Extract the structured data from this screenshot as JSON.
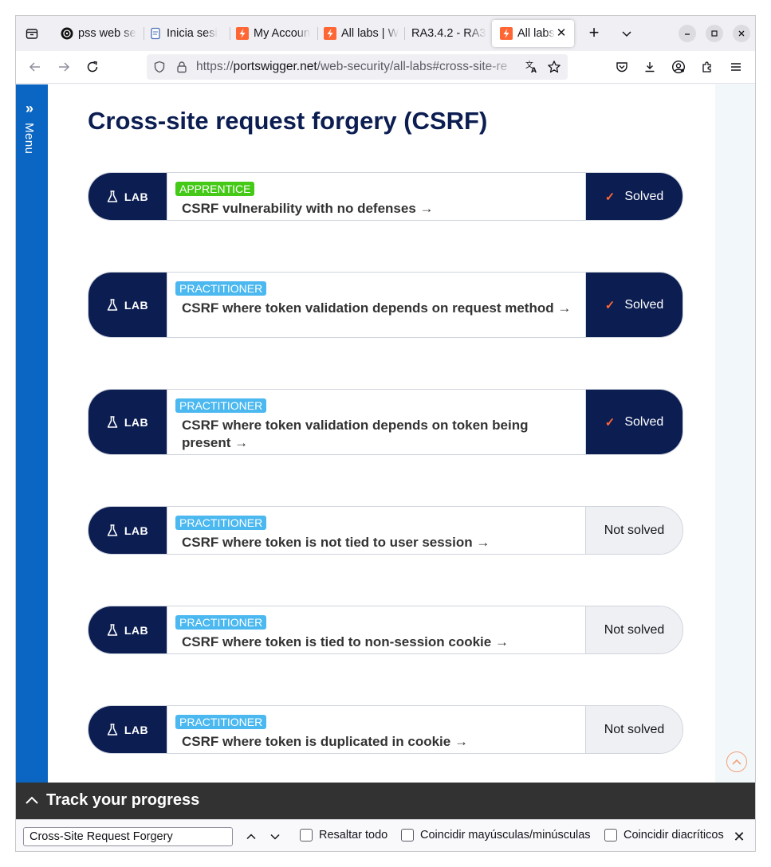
{
  "browser": {
    "tabs": [
      {
        "label": "pss web se",
        "icon": "openai-icon"
      },
      {
        "label": "Inicia sesi",
        "icon": "document-icon"
      },
      {
        "label": "My Accoun",
        "icon": "portswigger-icon"
      },
      {
        "label": "All labs | W",
        "icon": "portswigger-icon"
      },
      {
        "label": "RA3.4.2 - RA3",
        "icon": "none"
      },
      {
        "label": "All labs |",
        "icon": "portswigger-icon",
        "active": true
      }
    ],
    "url": {
      "scheme": "https://",
      "host": "portswigger.net",
      "path": "/web-security/all-labs#cross-site-re"
    }
  },
  "sidebar": {
    "menu_label": "Menu"
  },
  "page": {
    "title": "Cross-site request forgery (CSRF)",
    "badge_label": "LAB",
    "labs": [
      {
        "level": "APPRENTICE",
        "title": "CSRF vulnerability with no defenses",
        "status": "Solved",
        "solved": true
      },
      {
        "level": "PRACTITIONER",
        "title": "CSRF where token validation depends on request method",
        "status": "Solved",
        "solved": true
      },
      {
        "level": "PRACTITIONER",
        "title": "CSRF where token validation depends on token being present",
        "status": "Solved",
        "solved": true
      },
      {
        "level": "PRACTITIONER",
        "title": "CSRF where token is not tied to user session",
        "status": "Not solved",
        "solved": false
      },
      {
        "level": "PRACTITIONER",
        "title": "CSRF where token is tied to non-session cookie",
        "status": "Not solved",
        "solved": false
      },
      {
        "level": "PRACTITIONER",
        "title": "CSRF where token is duplicated in cookie",
        "status": "Not solved",
        "solved": false
      }
    ],
    "track_progress_label": "Track your progress"
  },
  "findbar": {
    "query": "Cross-Site Request Forgery",
    "highlight_all": "Resaltar todo",
    "match_case": "Coincidir mayúsculas/minúsculas",
    "match_diacritics": "Coincidir diacríticos"
  },
  "colors": {
    "navy": "#0b1d51",
    "menu_blue": "#0a66c2",
    "apprentice_green": "#43c916",
    "practitioner_blue": "#4bb8f0",
    "check_orange": "#ff6633"
  }
}
